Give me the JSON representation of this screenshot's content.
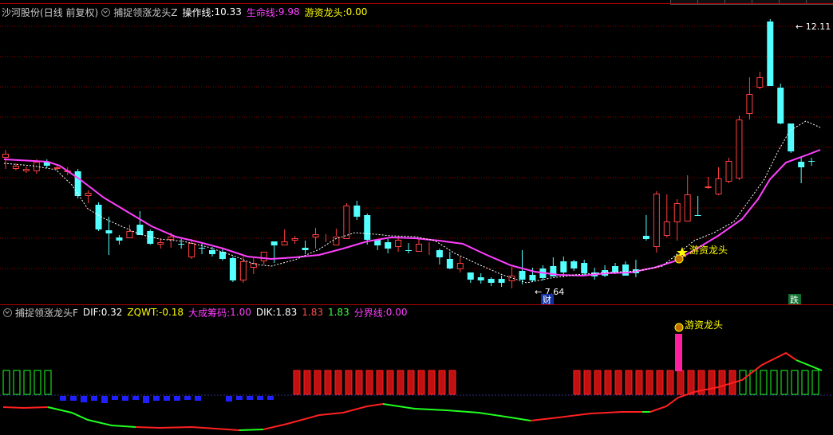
{
  "main_panel": {
    "stock_name": "沙河股份",
    "period_info": "(日线 前复权)",
    "indicator_name": "捕捉领涨龙头Z",
    "op_label": "操作线:",
    "op_value": "10.33",
    "life_label": "生命线:",
    "life_value": "9.98",
    "hot_label": "游资龙头:",
    "hot_value": "0.00",
    "high_label": "12.11",
    "low_label": "7.64",
    "signal_label": "游资龙头",
    "marker_cai": "财",
    "marker_die": "跌"
  },
  "sub_panel": {
    "indicator_name": "捕捉领涨龙头F",
    "dif_label": "DIF:",
    "dif_value": "0.32",
    "zqwt_label": "ZQWT:",
    "zqwt_value": "-0.18",
    "chip_label": "大成筹码:",
    "chip_value": "1.00",
    "dik_label": "DIK:",
    "dik_value": "1.83",
    "v2": "1.83",
    "v3": "1.83",
    "border_label": "分界线:",
    "border_value": "0.00",
    "signal_label": "游资龙头"
  },
  "colors": {
    "up": "#ff4040",
    "down": "#54ffff",
    "life_line": "#ff40ff",
    "op_line": "#ffffff",
    "grid": "#8b0000",
    "axis": "#b00000",
    "bar_red": "#ff2020",
    "bar_green": "#20ff20",
    "bar_blue": "#2020ff"
  },
  "chart_data": {
    "type": "candlestick",
    "candles": [
      [
        198,
        193,
        188,
        212
      ],
      [
        212,
        208,
        205,
        214
      ],
      [
        215,
        212,
        209,
        217
      ],
      [
        215,
        203,
        200,
        218
      ],
      [
        203,
        208,
        200,
        211
      ],
      [
        212,
        210,
        207,
        214
      ],
      [
        216,
        214,
        210,
        220
      ],
      [
        215,
        246,
        212,
        249
      ],
      [
        246,
        242,
        239,
        255
      ],
      [
        257,
        288,
        254,
        290
      ],
      [
        289,
        293,
        272,
        320
      ],
      [
        298,
        302,
        295,
        307
      ],
      [
        299,
        290,
        282,
        294
      ],
      [
        282,
        295,
        265,
        292
      ],
      [
        290,
        306,
        288,
        307
      ],
      [
        307,
        304,
        300,
        312
      ],
      [
        301,
        297,
        292,
        311
      ],
      [
        306,
        306,
        300,
        312
      ],
      [
        323,
        305,
        300,
        325
      ],
      [
        311,
        311,
        306,
        319
      ],
      [
        314,
        319,
        310,
        322
      ],
      [
        316,
        325,
        312,
        327
      ],
      [
        324,
        352,
        322,
        354
      ],
      [
        352,
        328,
        322,
        355
      ],
      [
        336,
        330,
        324,
        344
      ],
      [
        328,
        316,
        316,
        332
      ],
      [
        303,
        308,
        303,
        330
      ],
      [
        308,
        303,
        288,
        306
      ],
      [
        302,
        299,
        296,
        306
      ],
      [
        311,
        314,
        302,
        319
      ],
      [
        298,
        294,
        286,
        312
      ],
      [
        298,
        297,
        294,
        304
      ],
      [
        308,
        297,
        287,
        296
      ],
      [
        300,
        258,
        255,
        296
      ],
      [
        258,
        272,
        252,
        276
      ],
      [
        270,
        301,
        268,
        307
      ],
      [
        301,
        308,
        300,
        314
      ],
      [
        304,
        312,
        300,
        318
      ],
      [
        310,
        301,
        297,
        316
      ],
      [
        314,
        314,
        305,
        318
      ],
      [
        316,
        306,
        300,
        310
      ],
      [
        315,
        314,
        304,
        320
      ],
      [
        314,
        323,
        312,
        332
      ],
      [
        325,
        337,
        316,
        338
      ],
      [
        338,
        330,
        322,
        342
      ],
      [
        342,
        351,
        342,
        355
      ],
      [
        348,
        352,
        343,
        356
      ],
      [
        350,
        355,
        348,
        359
      ],
      [
        350,
        355,
        346,
        360
      ],
      [
        353,
        346,
        335,
        362
      ],
      [
        340,
        351,
        314,
        357
      ],
      [
        345,
        352,
        336,
        354
      ],
      [
        337,
        349,
        333,
        352
      ],
      [
        334,
        347,
        323,
        347
      ],
      [
        328,
        342,
        322,
        348
      ],
      [
        328,
        337,
        326,
        340
      ],
      [
        330,
        343,
        326,
        345
      ],
      [
        342,
        347,
        336,
        351
      ],
      [
        339,
        346,
        333,
        348
      ],
      [
        334,
        343,
        330,
        344
      ],
      [
        332,
        346,
        328,
        346
      ],
      [
        338,
        343,
        326,
        348
      ],
      [
        296,
        300,
        270,
        302
      ],
      [
        310,
        243,
        240,
        317
      ],
      [
        296,
        278,
        244,
        298
      ],
      [
        279,
        255,
        250,
        302
      ],
      [
        278,
        244,
        220,
        277
      ],
      [
        270,
        270,
        246,
        270
      ],
      [
        236,
        234,
        222,
        237
      ],
      [
        244,
        224,
        210,
        245
      ],
      [
        228,
        202,
        198,
        230
      ],
      [
        224,
        150,
        145,
        226
      ],
      [
        143,
        118,
        97,
        150
      ],
      [
        110,
        97,
        90,
        112
      ],
      [
        27,
        108,
        24,
        107
      ],
      [
        110,
        155,
        105,
        156
      ],
      [
        155,
        190,
        155,
        192
      ],
      [
        203,
        210,
        198,
        230
      ],
      [
        202,
        202,
        198,
        208
      ]
    ]
  }
}
